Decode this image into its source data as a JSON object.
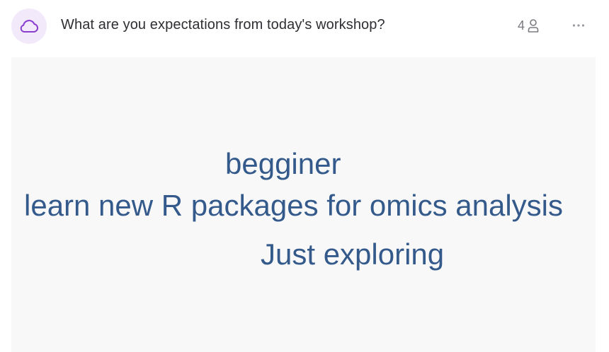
{
  "header": {
    "title": "What are you expectations from today's workshop?",
    "participant_count": "4",
    "accent_color": "#8a3ed0"
  },
  "icons": {
    "question_type": "cloud-icon",
    "participants": "person-icon",
    "menu": "more-horizontal-icon"
  },
  "word_cloud": {
    "words": [
      {
        "text": "begginer"
      },
      {
        "text": "learn new R packages for omics analysis"
      },
      {
        "text": "Just exploring"
      }
    ],
    "word_color": "#345a8c"
  }
}
